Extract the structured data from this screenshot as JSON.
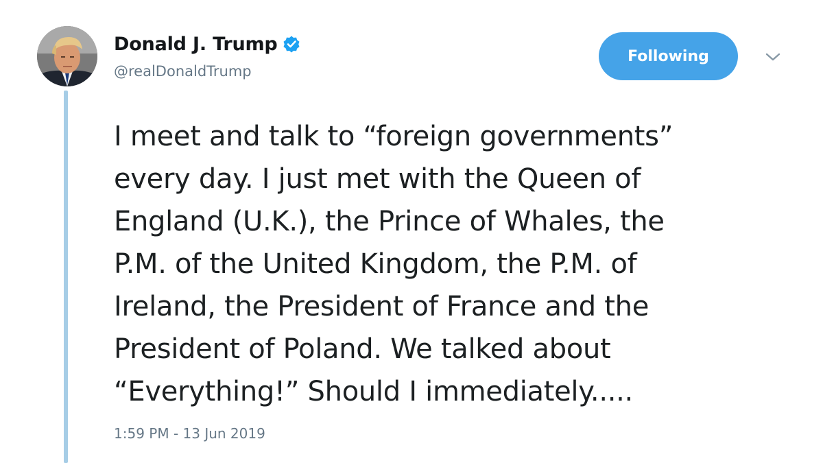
{
  "author": {
    "display_name": "Donald J. Trump",
    "handle": "@realDonaldTrump",
    "verified": true,
    "verified_icon": "verified-badge-icon",
    "avatar": "profile-photo"
  },
  "actions": {
    "follow_label": "Following",
    "more_icon": "chevron-down-icon"
  },
  "tweet": {
    "lines": [
      "I meet and talk to “foreign governments”",
      "every day. I just met with the Queen of",
      "England (U.K.), the Prince of Whales, the",
      "P.M. of the United Kingdom, the P.M. of",
      "Ireland, the President of France and the",
      "President of Poland. We talked about",
      "“Everything!” Should I immediately....."
    ],
    "timestamp": "1:59 PM - 13 Jun 2019"
  },
  "colors": {
    "accent": "#45a3e8",
    "thread_line": "#a6cde6",
    "secondary_text": "#657786",
    "verified": "#1da1f2"
  }
}
